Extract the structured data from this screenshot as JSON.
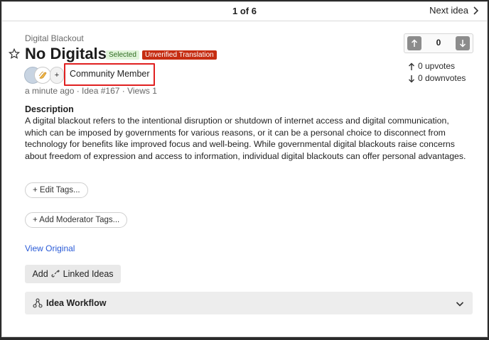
{
  "topbar": {
    "pager": "1 of 6",
    "next_label": "Next idea"
  },
  "idea": {
    "category": "Digital Blackout",
    "title": "No Digitals",
    "badge_selected": "Selected",
    "badge_unverified": "Unverified Translation",
    "member_label": "Community Member",
    "avatar_plus": "+",
    "meta": "a minute ago  · Idea #167 · Views 1",
    "description_heading": "Description",
    "description": "A digital blackout refers to the intentional disruption or shutdown of internet access and digital communication, which can be imposed by governments for various reasons, or it can be a personal choice to disconnect from technology for benefits like improved focus and well-being. While governmental digital blackouts raise concerns about freedom of expression and access to information, individual digital blackouts can offer personal advantages."
  },
  "votes": {
    "count": "0",
    "upvotes": "0 upvotes",
    "downvotes": "0 downvotes"
  },
  "actions": {
    "edit_tags": "+ Edit Tags...",
    "moderator_tags": "+ Add Moderator Tags...",
    "view_original": "View Original",
    "add_linked_prefix": "Add",
    "add_linked_suffix": "Linked Ideas",
    "workflow": "Idea Workflow"
  },
  "colors": {
    "badge_selected_bg": "#dff3d8",
    "badge_unverified_bg": "#c62d12",
    "highlight_border": "#e02020",
    "link": "#2a5bd7"
  },
  "icons": [
    "star-icon",
    "chevron-right-icon",
    "arrow-up-icon",
    "arrow-down-icon",
    "link-icon",
    "workflow-icon",
    "chevron-down-icon"
  ]
}
